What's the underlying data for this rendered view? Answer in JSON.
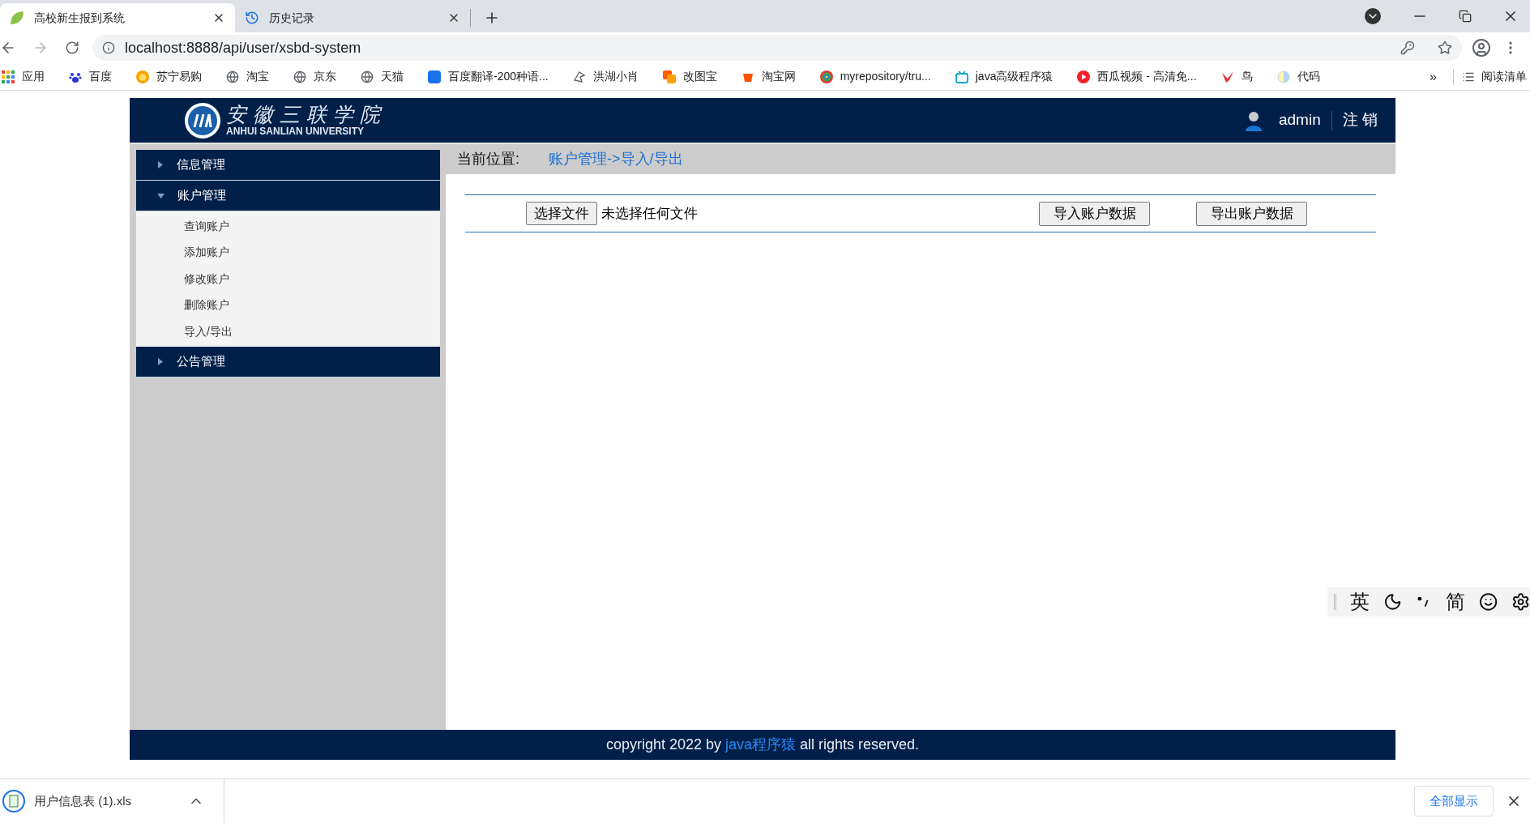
{
  "browser": {
    "tabs": [
      {
        "title": "高校新生报到系统",
        "selected": true
      },
      {
        "title": "历史记录",
        "selected": false
      }
    ],
    "address": "localhost:8888/api/user/xsbd-system",
    "bookmarks": [
      "应用",
      "百度",
      "苏宁易购",
      "淘宝",
      "京东",
      "天猫",
      "百度翻译-200种语...",
      "洪湖小肖",
      "改图宝",
      "淘宝网",
      "myrepository/tru...",
      "java高级程序猿",
      "西瓜视频 - 高清免...",
      "鸟",
      "代码"
    ],
    "more": "»",
    "reading_list": "阅读清单"
  },
  "header": {
    "logo_cn": "安徽三联学院",
    "logo_en": "ANHUI SANLIAN UNIVERSITY",
    "user": "admin",
    "logout": "注 销"
  },
  "sidebar": [
    {
      "label": "信息管理",
      "expanded": false
    },
    {
      "label": "账户管理",
      "expanded": true,
      "children": [
        {
          "label": "查询账户"
        },
        {
          "label": "添加账户"
        },
        {
          "label": "修改账户"
        },
        {
          "label": "删除账户"
        },
        {
          "label": "导入/导出"
        }
      ]
    },
    {
      "label": "公告管理",
      "expanded": false
    }
  ],
  "breadcrumb": {
    "label": "当前位置:",
    "path": "账户管理->导入/导出"
  },
  "file_panel": {
    "choose_button": "选择文件",
    "file_status": "未选择任何文件",
    "import_button": "导入账户数据",
    "export_button": "导出账户数据"
  },
  "footer": {
    "before": "copyright 2022 by ",
    "link": "java程序猿",
    "after": " all rights reserved."
  },
  "download_bar": {
    "file": "用户信息表 (1).xls",
    "show_all": "全部显示"
  },
  "ime_toolbar": {
    "mode": "英",
    "script": "简"
  }
}
